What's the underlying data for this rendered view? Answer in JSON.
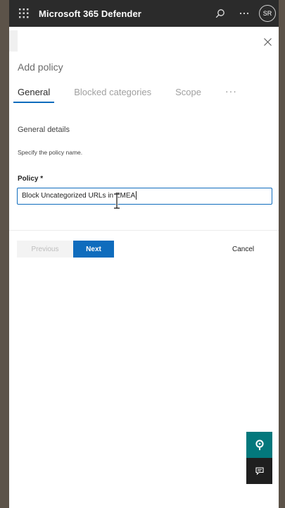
{
  "topbar": {
    "app_title": "Microsoft 365 Defender",
    "user_initials": "SR",
    "icons": [
      "waffle-icon",
      "search-icon",
      "more-icon"
    ]
  },
  "panel": {
    "title": "Add policy",
    "tabs": [
      {
        "label": "General",
        "active": true
      },
      {
        "label": "Blocked categories",
        "active": false
      },
      {
        "label": "Scope",
        "active": false
      }
    ],
    "tabs_more": "···",
    "section_title": "General details",
    "section_desc": "Specify the policy name.",
    "policy_label": "Policy *",
    "policy_value": "Block Uncategorized URLs in EMEA"
  },
  "footer": {
    "previous_label": "Previous",
    "next_label": "Next",
    "cancel_label": "Cancel"
  },
  "colors": {
    "accent": "#0f6cbd",
    "topbar": "#2b2b2b",
    "help": "#03787c"
  }
}
